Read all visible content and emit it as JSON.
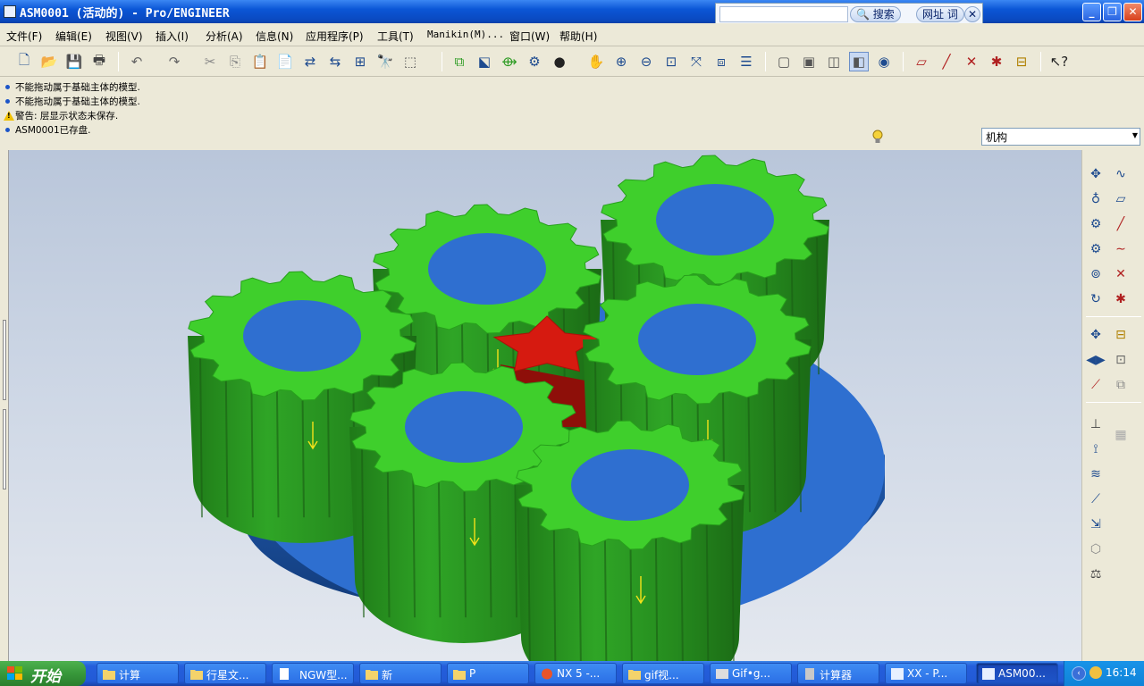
{
  "window": {
    "title": "ASM0001 (活动的) - Pro/ENGINEER"
  },
  "search_bar": {
    "search_label": "搜索",
    "url_label": "网址",
    "word_label": "词"
  },
  "menu": [
    {
      "label": "文件(F)"
    },
    {
      "label": "编辑(E)"
    },
    {
      "label": "视图(V)"
    },
    {
      "label": "插入(I)"
    },
    {
      "label": "分析(A)"
    },
    {
      "label": "信息(N)"
    },
    {
      "label": "应用程序(P)"
    },
    {
      "label": "工具(T)"
    },
    {
      "label": "Manikin(M)..."
    },
    {
      "label": "窗口(W)"
    },
    {
      "label": "帮助(H)"
    }
  ],
  "toolbar_icons": [
    "new-file-icon",
    "open-folder-icon",
    "save-icon",
    "print-icon",
    "undo-icon",
    "redo-icon",
    "cut-icon",
    "copy-icon",
    "paste-icon",
    "paste-special-icon",
    "regenerate-icon",
    "regen-manager-icon",
    "model-tree-icon",
    "find-icon",
    "select-box-icon",
    "component-placement-icon",
    "mechanism-icon",
    "connection-icon",
    "servo-icon",
    "sphere-display-icon",
    "pan-hand-icon",
    "zoom-in-icon",
    "zoom-out-icon",
    "refit-icon",
    "reorient-icon",
    "saved-views-icon",
    "layers-icon",
    "wireframe-icon",
    "hidden-line-icon",
    "no-hidden-icon",
    "shaded-icon",
    "enhanced-realism-icon",
    "datum-plane-icon",
    "datum-axis-icon",
    "datum-point-icon",
    "csys-icon",
    "annotation-icon",
    "whats-this-icon"
  ],
  "messages": [
    {
      "type": "info",
      "text": "不能拖动属于基础主体的模型."
    },
    {
      "type": "info",
      "text": "不能拖动属于基础主体的模型."
    },
    {
      "type": "warning",
      "text": "警告: 层显示状态未保存."
    },
    {
      "type": "info",
      "text": "ASM0001已存盘."
    }
  ],
  "mechanism_selector": {
    "value": "机构"
  },
  "colors": {
    "gear_green": "#3fcf2c",
    "gear_side": "#2f9a25",
    "gear_bore": "#2f6fd0",
    "sun_gear_red": "#d61a10",
    "base_plate": "#2e6fd0",
    "viewport_bg": "#c4cfe0"
  },
  "taskbar": {
    "start_label": "开始",
    "tasks": [
      {
        "label": "计算"
      },
      {
        "label": "行星文..."
      },
      {
        "label": "NGW型..."
      },
      {
        "label": "新"
      },
      {
        "label": "P"
      },
      {
        "label": "NX 5 -..."
      },
      {
        "label": "gif视..."
      },
      {
        "label": "Gif•g..."
      },
      {
        "label": "计算器"
      },
      {
        "label": "XX - P..."
      },
      {
        "label": "ASM00..."
      }
    ],
    "clock": "16:14"
  }
}
